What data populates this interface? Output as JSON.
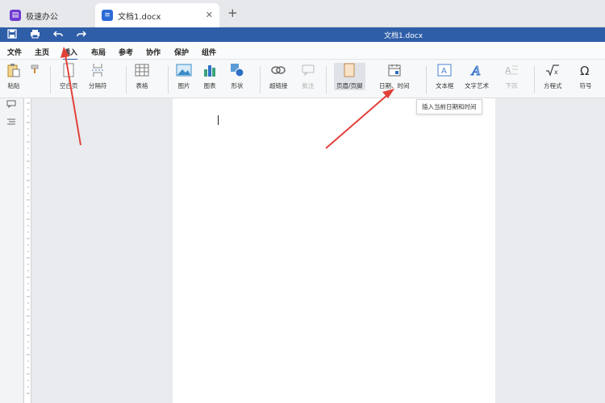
{
  "tabs": [
    {
      "label": "极速办公"
    },
    {
      "label": "文档1.docx"
    }
  ],
  "new_tab_symbol": "+",
  "close_symbol": "✕",
  "title": "文档1.docx",
  "menu": [
    "文件",
    "主页",
    "插入",
    "布局",
    "参考",
    "协作",
    "保护",
    "组件"
  ],
  "ribbon": {
    "paste": "粘贴",
    "blank_page": "空白页",
    "break": "分隔符",
    "table": "表格",
    "picture": "图片",
    "chart": "图表",
    "shape": "形状",
    "hyperlink": "超链接",
    "comment": "批注",
    "header_footer": "页眉/页脚",
    "date_time": "日期、时间",
    "textbox": "文本框",
    "wordart": "文字艺术",
    "dropcap": "下沉",
    "equation": "方程式",
    "symbol": "符号"
  },
  "tooltip": "插入当前日期和时间",
  "colors": {
    "brand": "#2f5ea8",
    "arrow": "#e2413a"
  }
}
